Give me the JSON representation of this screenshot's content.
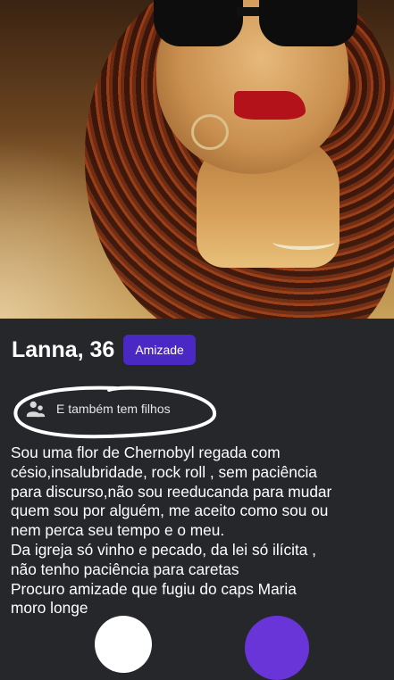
{
  "profile": {
    "name_age": "Lanna, 36",
    "badge": "Amizade",
    "children_text": "E também tem filhos",
    "bio": [
      "Sou uma flor de Chernobyl regada com",
      "césio,insalubridade, rock roll , sem paciência",
      "para discurso,não sou reeducanda para mudar",
      "quem sou por alguém, me aceito como sou ou",
      "nem perca seu tempo e o meu.",
      "Da igreja só vinho e pecado, da lei só ilícita ,",
      "não tenho paciência para caretas",
      "Procuro amizade que fugiu do caps Maria",
      "moro longe"
    ]
  },
  "icons": {
    "children": "people-icon"
  },
  "colors": {
    "background": "#26272b",
    "badge": "#4a28c4",
    "action_right": "#6a35d8"
  }
}
